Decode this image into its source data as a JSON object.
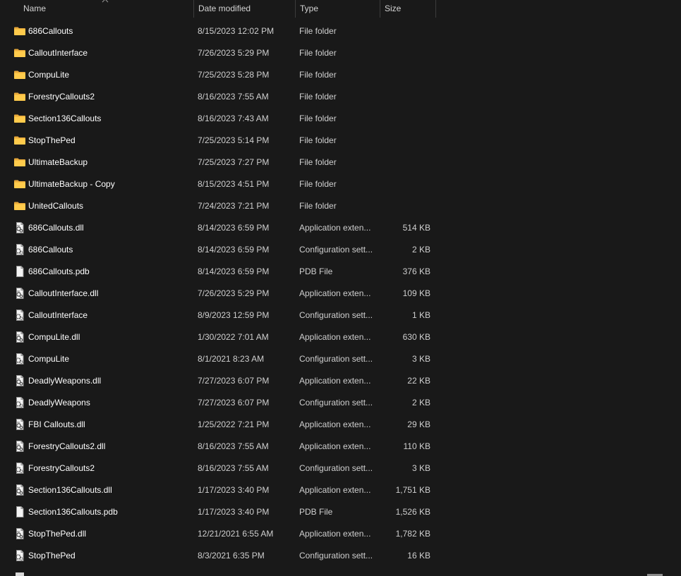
{
  "columns": {
    "name": "Name",
    "date": "Date modified",
    "type": "Type",
    "size": "Size"
  },
  "files": [
    {
      "name": "686Callouts",
      "date": "8/15/2023 12:02 PM",
      "type": "File folder",
      "size": "",
      "icon": "folder-icon"
    },
    {
      "name": "CalloutInterface",
      "date": "7/26/2023 5:29 PM",
      "type": "File folder",
      "size": "",
      "icon": "folder-icon"
    },
    {
      "name": "CompuLite",
      "date": "7/25/2023 5:28 PM",
      "type": "File folder",
      "size": "",
      "icon": "folder-icon"
    },
    {
      "name": "ForestryCallouts2",
      "date": "8/16/2023 7:55 AM",
      "type": "File folder",
      "size": "",
      "icon": "folder-icon"
    },
    {
      "name": "Section136Callouts",
      "date": "8/16/2023 7:43 AM",
      "type": "File folder",
      "size": "",
      "icon": "folder-icon"
    },
    {
      "name": "StopThePed",
      "date": "7/25/2023 5:14 PM",
      "type": "File folder",
      "size": "",
      "icon": "folder-icon"
    },
    {
      "name": "UltimateBackup",
      "date": "7/25/2023 7:27 PM",
      "type": "File folder",
      "size": "",
      "icon": "folder-icon"
    },
    {
      "name": "UltimateBackup - Copy",
      "date": "8/15/2023 4:51 PM",
      "type": "File folder",
      "size": "",
      "icon": "folder-icon"
    },
    {
      "name": "UnitedCallouts",
      "date": "7/24/2023 7:21 PM",
      "type": "File folder",
      "size": "",
      "icon": "folder-icon"
    },
    {
      "name": "686Callouts.dll",
      "date": "8/14/2023 6:59 PM",
      "type": "Application exten...",
      "size": "514 KB",
      "icon": "dll-file-icon"
    },
    {
      "name": "686Callouts",
      "date": "8/14/2023 6:59 PM",
      "type": "Configuration sett...",
      "size": "2 KB",
      "icon": "config-file-icon"
    },
    {
      "name": "686Callouts.pdb",
      "date": "8/14/2023 6:59 PM",
      "type": "PDB File",
      "size": "376 KB",
      "icon": "blank-file-icon"
    },
    {
      "name": "CalloutInterface.dll",
      "date": "7/26/2023 5:29 PM",
      "type": "Application exten...",
      "size": "109 KB",
      "icon": "dll-file-icon"
    },
    {
      "name": "CalloutInterface",
      "date": "8/9/2023 12:59 PM",
      "type": "Configuration sett...",
      "size": "1 KB",
      "icon": "config-file-icon"
    },
    {
      "name": "CompuLite.dll",
      "date": "1/30/2022 7:01 AM",
      "type": "Application exten...",
      "size": "630 KB",
      "icon": "dll-file-icon"
    },
    {
      "name": "CompuLite",
      "date": "8/1/2021 8:23 AM",
      "type": "Configuration sett...",
      "size": "3 KB",
      "icon": "config-file-icon"
    },
    {
      "name": "DeadlyWeapons.dll",
      "date": "7/27/2023 6:07 PM",
      "type": "Application exten...",
      "size": "22 KB",
      "icon": "dll-file-icon"
    },
    {
      "name": "DeadlyWeapons",
      "date": "7/27/2023 6:07 PM",
      "type": "Configuration sett...",
      "size": "2 KB",
      "icon": "config-file-icon"
    },
    {
      "name": "FBI Callouts.dll",
      "date": "1/25/2022 7:21 PM",
      "type": "Application exten...",
      "size": "29 KB",
      "icon": "dll-file-icon"
    },
    {
      "name": "ForestryCallouts2.dll",
      "date": "8/16/2023 7:55 AM",
      "type": "Application exten...",
      "size": "110 KB",
      "icon": "dll-file-icon"
    },
    {
      "name": "ForestryCallouts2",
      "date": "8/16/2023 7:55 AM",
      "type": "Configuration sett...",
      "size": "3 KB",
      "icon": "config-file-icon"
    },
    {
      "name": "Section136Callouts.dll",
      "date": "1/17/2023 3:40 PM",
      "type": "Application exten...",
      "size": "1,751 KB",
      "icon": "dll-file-icon"
    },
    {
      "name": "Section136Callouts.pdb",
      "date": "1/17/2023 3:40 PM",
      "type": "PDB File",
      "size": "1,526 KB",
      "icon": "blank-file-icon"
    },
    {
      "name": "StopThePed.dll",
      "date": "12/21/2021 6:55 AM",
      "type": "Application exten...",
      "size": "1,782 KB",
      "icon": "dll-file-icon"
    },
    {
      "name": "StopThePed",
      "date": "8/3/2021 6:35 PM",
      "type": "Configuration sett...",
      "size": "16 KB",
      "icon": "config-file-icon"
    }
  ]
}
